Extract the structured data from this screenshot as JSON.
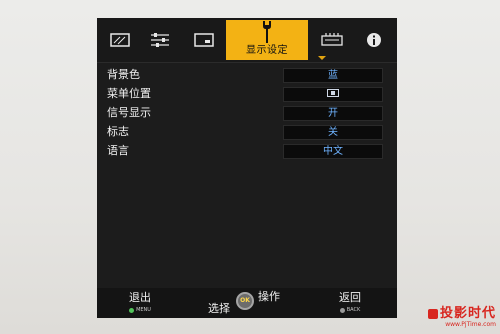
{
  "menu": {
    "tabs": [
      {
        "icon": "picture-icon"
      },
      {
        "icon": "sliders-icon"
      },
      {
        "icon": "display-icon"
      },
      {
        "icon": "wrench-icon",
        "label": "显示设定",
        "active": true
      },
      {
        "icon": "connector-icon"
      },
      {
        "icon": "info-icon"
      }
    ]
  },
  "settings": [
    {
      "label": "背景色",
      "value": "蓝"
    },
    {
      "label": "菜单位置",
      "value": "",
      "value_icon": "menu-position-icon"
    },
    {
      "label": "信号显示",
      "value": "开"
    },
    {
      "label": "标志",
      "value": "关"
    },
    {
      "label": "语言",
      "value": "中文"
    }
  ],
  "footer": {
    "exit": {
      "label": "退出",
      "sub": "MENU"
    },
    "select": {
      "label": "选择"
    },
    "ok": {
      "label": "OK"
    },
    "operate": {
      "label": "操作"
    },
    "back": {
      "label": "返回",
      "sub": "BACK"
    }
  },
  "watermark": {
    "brand": "投影时代",
    "url": "www.PjTime.com"
  },
  "colors": {
    "accent": "#f3b214",
    "value_text": "#6fb3ff",
    "panel": "#1c1c1c",
    "watermark": "#d8261f"
  }
}
